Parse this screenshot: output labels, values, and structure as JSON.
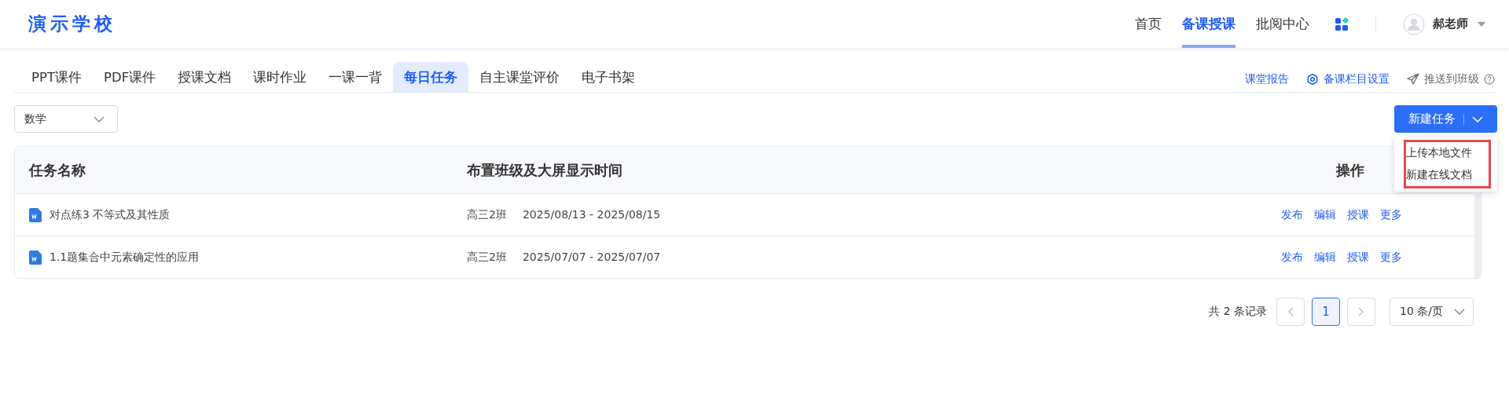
{
  "header": {
    "logo": "演示学校",
    "nav": [
      {
        "label": "首页",
        "selected": false
      },
      {
        "label": "备课授课",
        "selected": true
      },
      {
        "label": "批阅中心",
        "selected": false
      }
    ],
    "user": {
      "name": "郝老师"
    }
  },
  "tabs": [
    {
      "label": "PPT课件",
      "selected": false
    },
    {
      "label": "PDF课件",
      "selected": false
    },
    {
      "label": "授课文档",
      "selected": false
    },
    {
      "label": "课时作业",
      "selected": false
    },
    {
      "label": "一课一背",
      "selected": false
    },
    {
      "label": "每日任务",
      "selected": true
    },
    {
      "label": "自主课堂评价",
      "selected": false
    },
    {
      "label": "电子书架",
      "selected": false
    }
  ],
  "tab_actions": [
    {
      "kind": "link",
      "label": "课堂报告"
    },
    {
      "kind": "settings",
      "label": "备课栏目设置"
    },
    {
      "kind": "push",
      "label": "推送到班级"
    }
  ],
  "subject_select": {
    "value": "数学"
  },
  "new_button": {
    "label": "新建任务",
    "menu": {
      "highlighted": true,
      "items": [
        "上传本地文件",
        "新建在线文档"
      ]
    }
  },
  "table": {
    "columns": [
      "任务名称",
      "布置班级及大屏显示时间",
      "操作"
    ],
    "rows": [
      {
        "name": "对点练3 不等式及其性质",
        "class": "高三2班",
        "dates": "2025/08/13 - 2025/08/15",
        "actions": [
          "发布",
          "编辑",
          "授课",
          "更多"
        ]
      },
      {
        "name": "1.1题集合中元素确定性的应用",
        "class": "高三2班",
        "dates": "2025/07/07 - 2025/07/07",
        "actions": [
          "发布",
          "编辑",
          "授课",
          "更多"
        ]
      }
    ]
  },
  "pagination": {
    "total": "共 2 条记录",
    "pages": [
      {
        "label": "1",
        "selected": true
      }
    ],
    "page_size": "10 条/页"
  }
}
